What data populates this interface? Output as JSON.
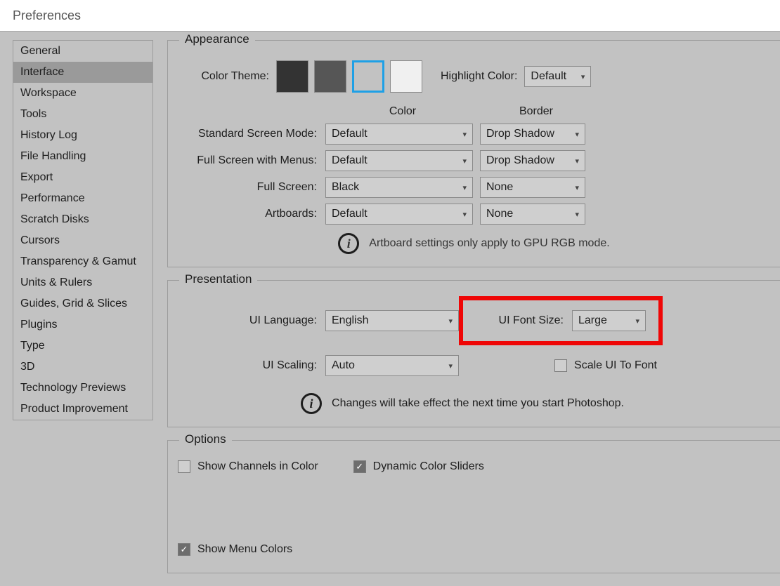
{
  "window": {
    "title": "Preferences"
  },
  "sidebar": {
    "items": [
      "General",
      "Interface",
      "Workspace",
      "Tools",
      "History Log",
      "File Handling",
      "Export",
      "Performance",
      "Scratch Disks",
      "Cursors",
      "Transparency & Gamut",
      "Units & Rulers",
      "Guides, Grid & Slices",
      "Plugins",
      "Type",
      "3D",
      "Technology Previews",
      "Product Improvement"
    ],
    "selected_index": 1
  },
  "appearance": {
    "legend": "Appearance",
    "color_theme_label": "Color Theme:",
    "swatches": [
      "#333333",
      "#565656",
      "#c2c2c2",
      "#f0f0f0"
    ],
    "selected_swatch_index": 2,
    "highlight_label": "Highlight Color:",
    "highlight_value": "Default",
    "headers": {
      "color": "Color",
      "border": "Border"
    },
    "modes": [
      {
        "label": "Standard Screen Mode:",
        "color": "Default",
        "border": "Drop Shadow"
      },
      {
        "label": "Full Screen with Menus:",
        "color": "Default",
        "border": "Drop Shadow"
      },
      {
        "label": "Full Screen:",
        "color": "Black",
        "border": "None"
      },
      {
        "label": "Artboards:",
        "color": "Default",
        "border": "None"
      }
    ],
    "info": "Artboard settings only apply to GPU RGB mode."
  },
  "presentation": {
    "legend": "Presentation",
    "ui_language_label": "UI Language:",
    "ui_language_value": "English",
    "ui_font_label": "UI Font Size:",
    "ui_font_value": "Large",
    "ui_scaling_label": "UI Scaling:",
    "ui_scaling_value": "Auto",
    "scale_to_font_label": "Scale UI To Font",
    "scale_to_font_checked": false,
    "info": "Changes will take effect the next time you start Photoshop."
  },
  "options": {
    "legend": "Options",
    "items": [
      {
        "label": "Show Channels in Color",
        "checked": false
      },
      {
        "label": "Dynamic Color Sliders",
        "checked": true
      },
      {
        "label": "Show Menu Colors",
        "checked": true
      }
    ]
  }
}
